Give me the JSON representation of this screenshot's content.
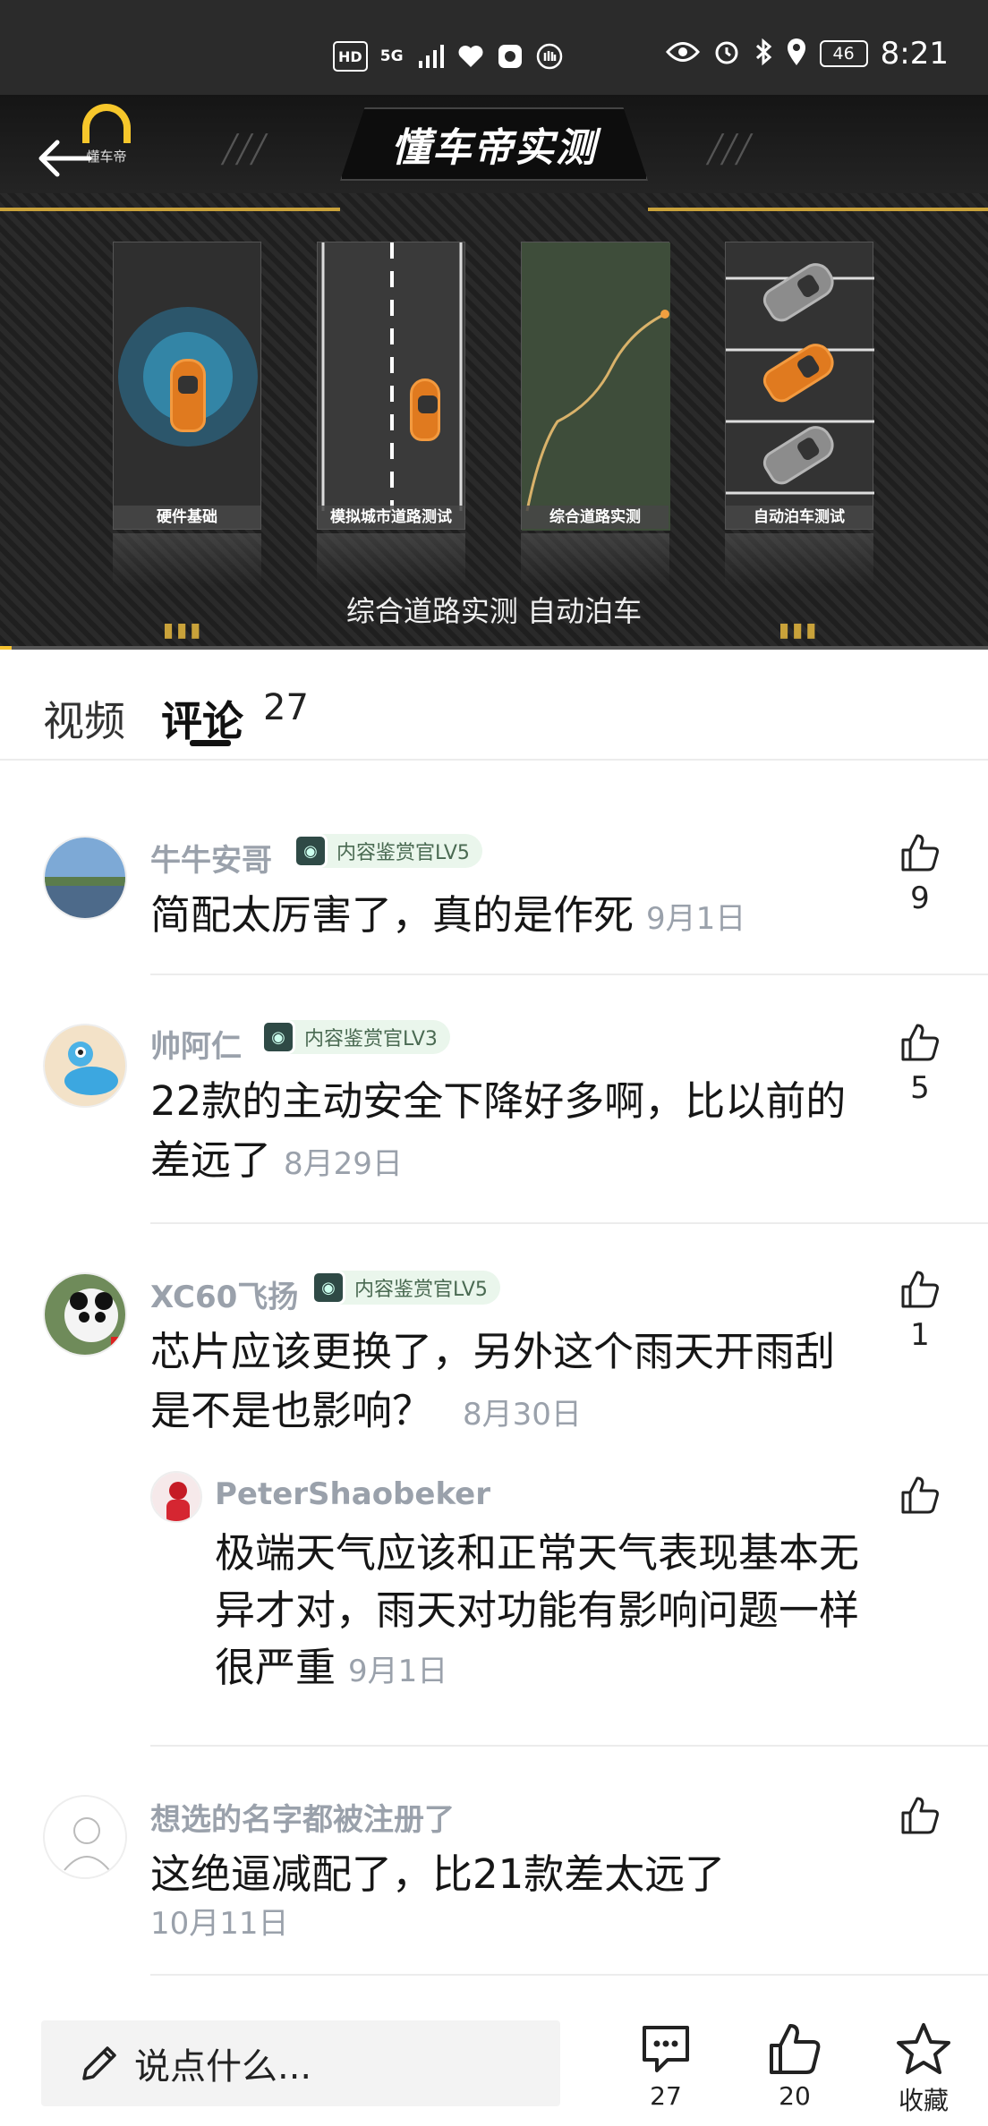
{
  "status_bar": {
    "left_icons": [
      "HD",
      "5G",
      "signal-icon",
      "heart-icon",
      "app-icon",
      "hand-icon"
    ],
    "right_icons": [
      "eye-icon",
      "alarm-icon",
      "bluetooth-icon",
      "location-icon"
    ],
    "battery": "46",
    "time": "8:21"
  },
  "video": {
    "brand_logo_text": "懂车帝",
    "title": "懂车帝实测",
    "panels": [
      "硬件基础",
      "模拟城市道路测试",
      "综合道路实测",
      "自动泊车测试"
    ],
    "subtitle": "综合道路实测 自动泊车",
    "progress": 0.012
  },
  "tabs": {
    "video": "视频",
    "comments": "评论",
    "comment_count": "27"
  },
  "comments": [
    {
      "user": "牛牛安哥",
      "badge": "内容鉴赏官LV5",
      "text": "简配太厉害了，真的是作死",
      "date": "9月1日",
      "likes": "9"
    },
    {
      "user": "帅阿仁",
      "badge": "内容鉴赏官LV3",
      "text": "22款的主动安全下降好多啊，比以前的差远了",
      "date": "8月29日",
      "likes": "5"
    },
    {
      "user": "XC60飞扬",
      "badge": "内容鉴赏官LV5",
      "text": "芯片应该更换了，另外这个雨天开雨刮是不是也影响？",
      "date": "8月30日",
      "likes": "1"
    },
    {
      "user": "想选的名字都被注册了",
      "badge": "",
      "text": "这绝逼减配了，比21款差太远了",
      "date": "10月11日",
      "likes": ""
    }
  ],
  "reply": {
    "user": "PeterShaobeker",
    "text": "极端天气应该和正常天气表现基本无异才对，雨天对功能有影响问题一样很严重",
    "date": "9月1日"
  },
  "bottom_bar": {
    "input_placeholder": "说点什么...",
    "comment_count": "27",
    "like_count": "20",
    "favorite_label": "收藏"
  },
  "colors": {
    "accent": "#f5c230",
    "gold": "#c9a23a",
    "muted": "#9aa1ab",
    "car": "#e07a1f"
  }
}
